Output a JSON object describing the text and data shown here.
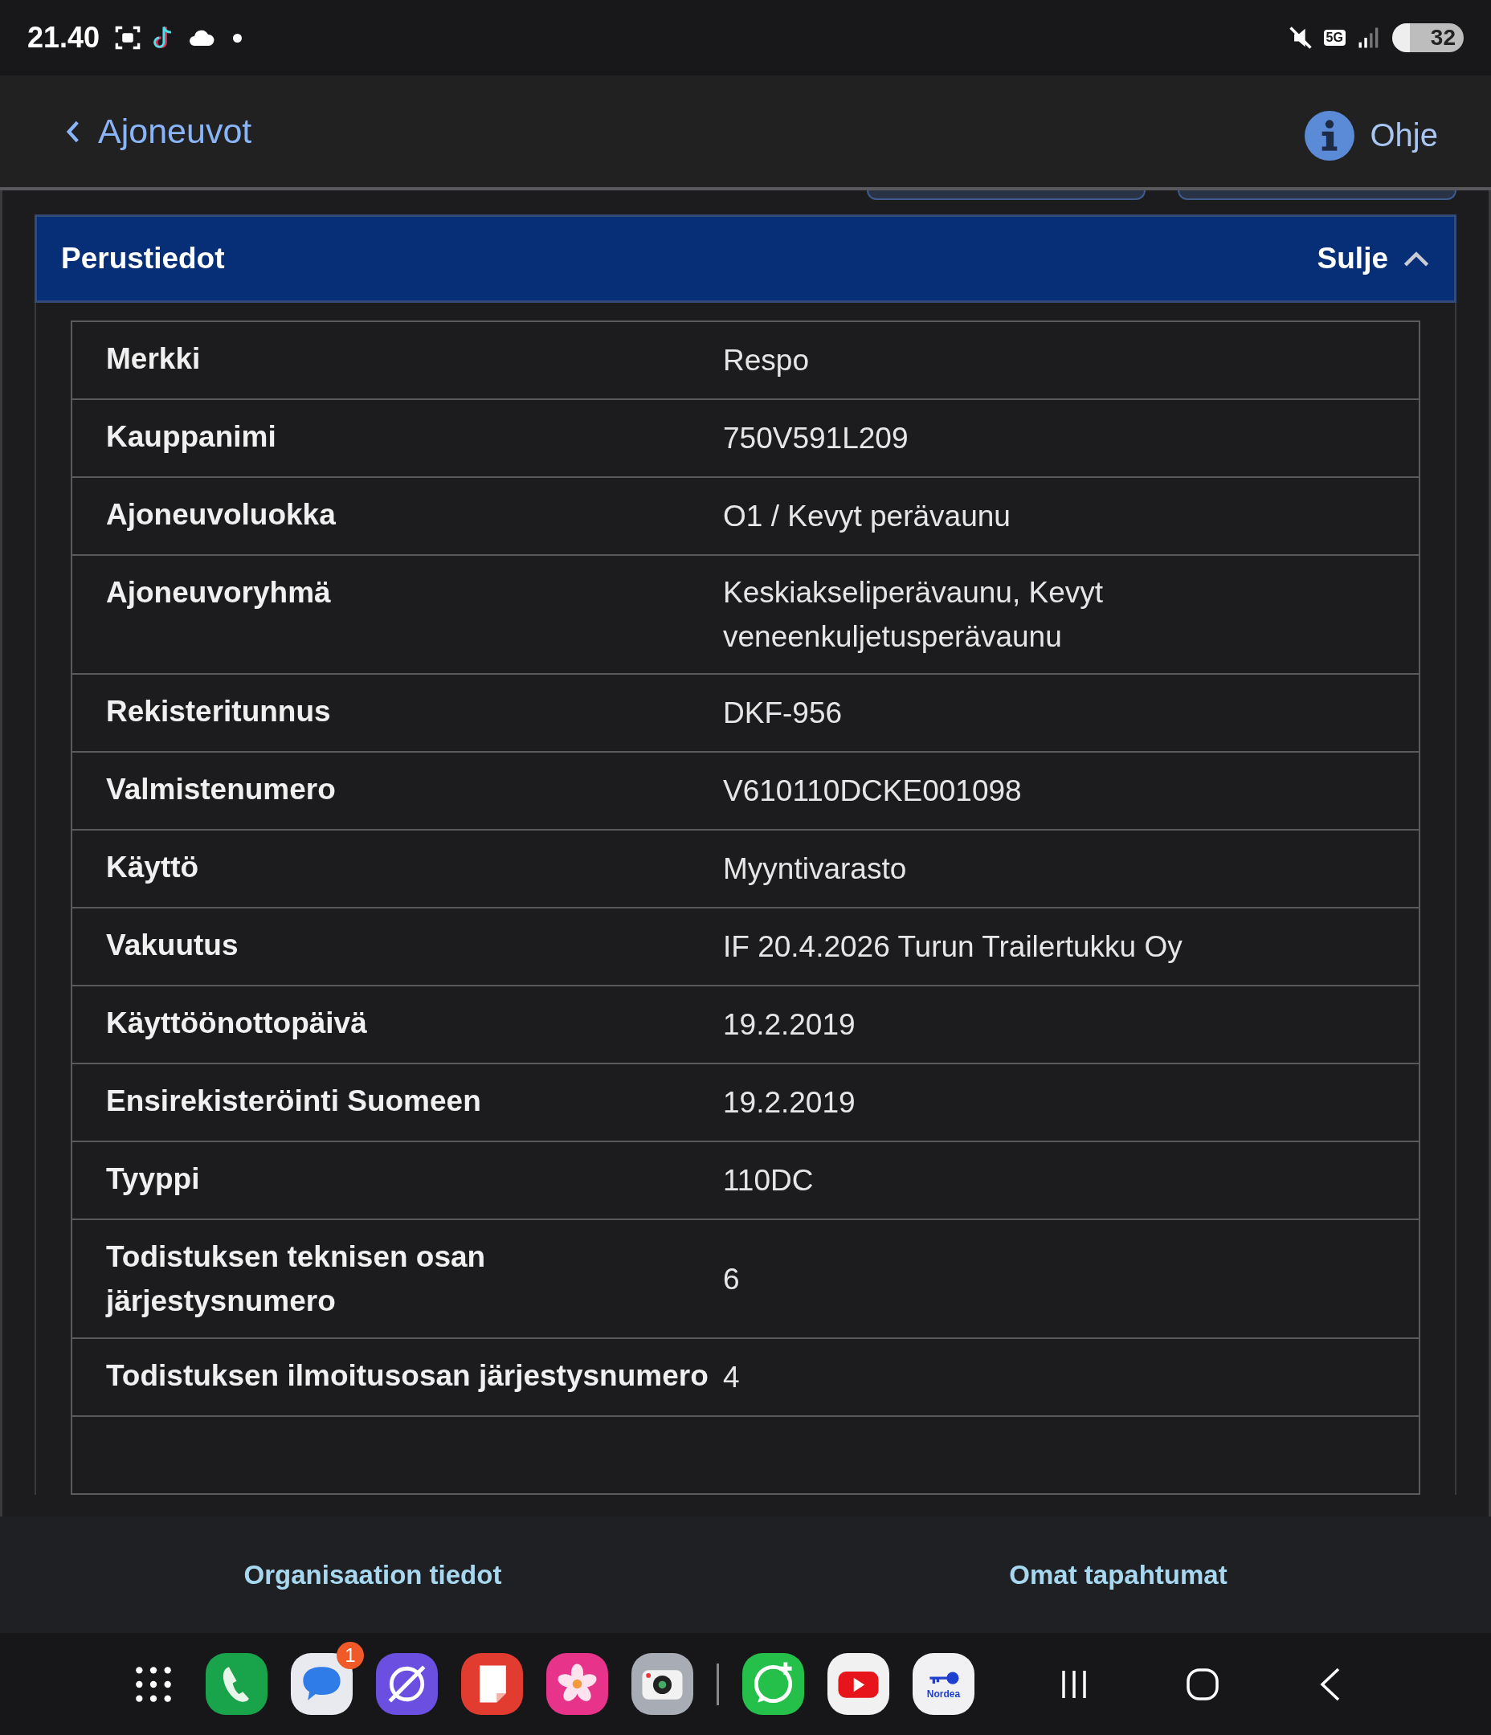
{
  "status_bar": {
    "time": "21.40",
    "network": "5G",
    "battery": "32"
  },
  "header": {
    "back": "Ajoneuvot",
    "help": "Ohje"
  },
  "section": {
    "title": "Perustiedot",
    "toggle": "Sulje",
    "expanded": true
  },
  "rows": [
    {
      "label": "Merkki",
      "value": "Respo"
    },
    {
      "label": "Kauppanimi",
      "value": "750V591L209"
    },
    {
      "label": "Ajoneuvoluokka",
      "value": "O1 / Kevyt perävaunu"
    },
    {
      "label": "Ajoneuvoryhmä",
      "value": "Keskiakseliperävaunu, Kevyt veneenkuljetusperävaunu"
    },
    {
      "label": "Rekisteritunnus",
      "value": "DKF-956"
    },
    {
      "label": "Valmistenumero",
      "value": "V610110DCKE001098"
    },
    {
      "label": "Käyttö",
      "value": "Myyntivarasto"
    },
    {
      "label": "Vakuutus",
      "value": "IF 20.4.2026 Turun Trailertukku Oy"
    },
    {
      "label": "Käyttöönottopäivä",
      "value": "19.2.2019"
    },
    {
      "label": "Ensirekisteröinti Suomeen",
      "value": "19.2.2019"
    },
    {
      "label": "Tyyppi",
      "value": "110DC"
    },
    {
      "label": "Todistuksen teknisen osan järjestysnumero",
      "value": "6"
    },
    {
      "label": "Todistuksen ilmoitusosan järjestysnumero",
      "value": "4"
    }
  ],
  "bottom_nav": [
    "Organisaation tiedot",
    "Omat tapahtumat"
  ],
  "dock": {
    "messages_badge": "1",
    "bank_label": "Nordea"
  }
}
